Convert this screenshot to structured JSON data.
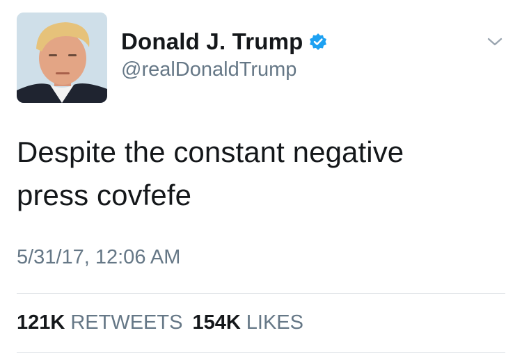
{
  "author": {
    "display_name": "Donald J. Trump",
    "handle": "@realDonaldTrump",
    "verified": true,
    "avatar_icon": "profile-photo"
  },
  "tweet": {
    "text_line1": "Despite the constant negative",
    "text_line2": "press covfefe",
    "timestamp": "5/31/17, 12:06 AM"
  },
  "stats": {
    "retweets_count": "121K",
    "retweets_label": "RETWEETS",
    "likes_count": "154K",
    "likes_label": "LIKES"
  },
  "icons": {
    "verified": "verified-badge-icon",
    "menu": "chevron-down-icon"
  },
  "colors": {
    "verified_blue": "#1da1f2",
    "secondary_text": "#657786",
    "primary_text": "#14171a",
    "divider": "#dadfe3"
  }
}
